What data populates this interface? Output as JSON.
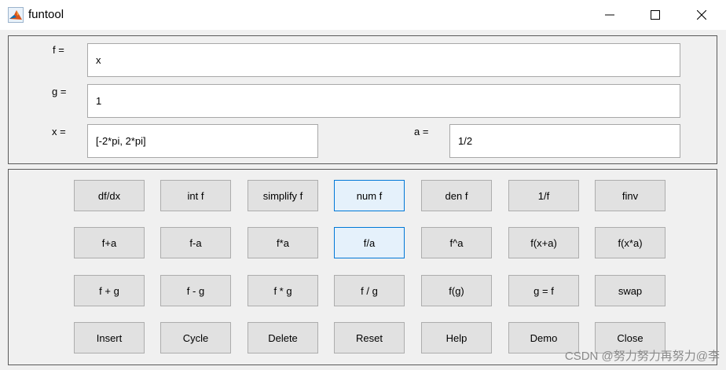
{
  "window": {
    "title": "funtool"
  },
  "inputs": {
    "f_label": "f =",
    "f_value": "x",
    "g_label": "g =",
    "g_value": "1",
    "x_label": "x =",
    "x_value": "[-2*pi, 2*pi]",
    "a_label": "a =",
    "a_value": "1/2"
  },
  "buttons": {
    "row1": [
      "df/dx",
      "int f",
      "simplify f",
      "num f",
      "den f",
      "1/f",
      "finv"
    ],
    "row2": [
      "f+a",
      "f-a",
      "f*a",
      "f/a",
      "f^a",
      "f(x+a)",
      "f(x*a)"
    ],
    "row3": [
      "f + g",
      "f - g",
      "f * g",
      "f / g",
      "f(g)",
      "g = f",
      "swap"
    ],
    "row4": [
      "Insert",
      "Cycle",
      "Delete",
      "Reset",
      "Help",
      "Demo",
      "Close"
    ]
  },
  "watermark": "CSDN @努力努力再努力@李"
}
